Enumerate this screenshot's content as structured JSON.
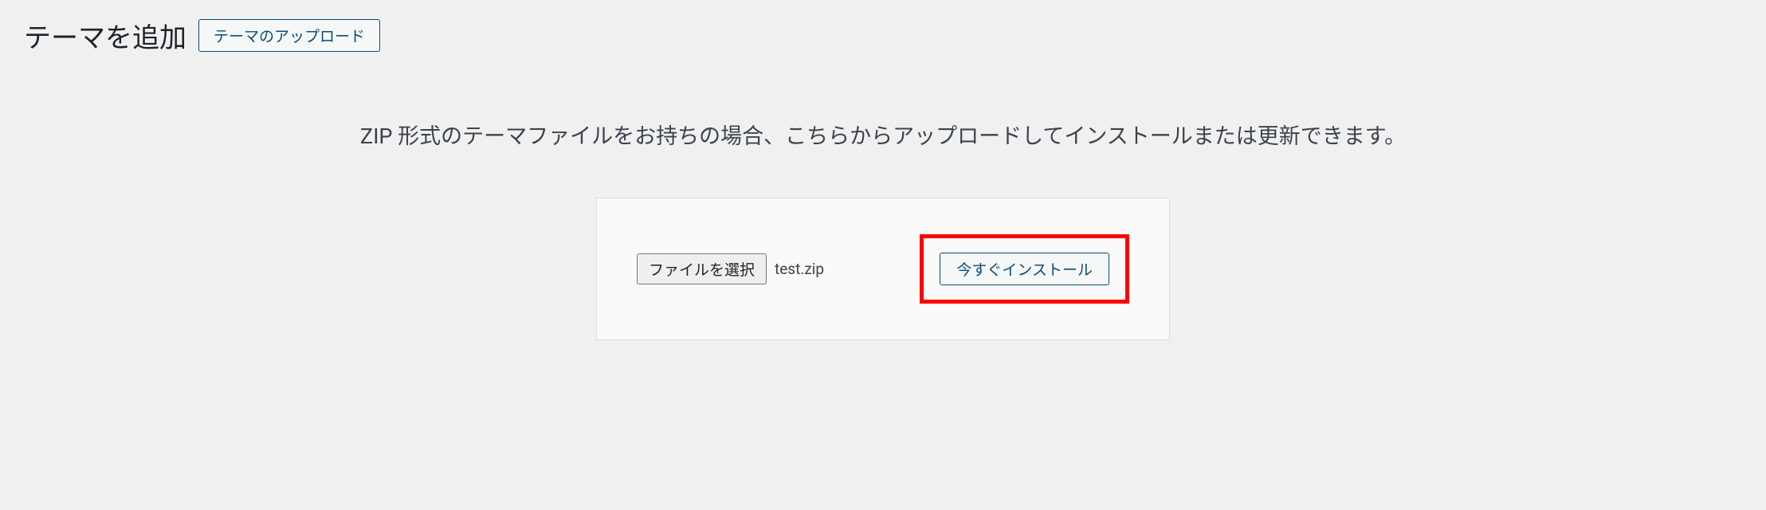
{
  "header": {
    "title": "テーマを追加",
    "uploadButton": "テーマのアップロード"
  },
  "main": {
    "description": "ZIP 形式のテーマファイルをお持ちの場合、こちらからアップロードしてインストールまたは更新できます。",
    "fileButton": "ファイルを選択",
    "fileName": "test.zip",
    "installButton": "今すぐインストール"
  }
}
